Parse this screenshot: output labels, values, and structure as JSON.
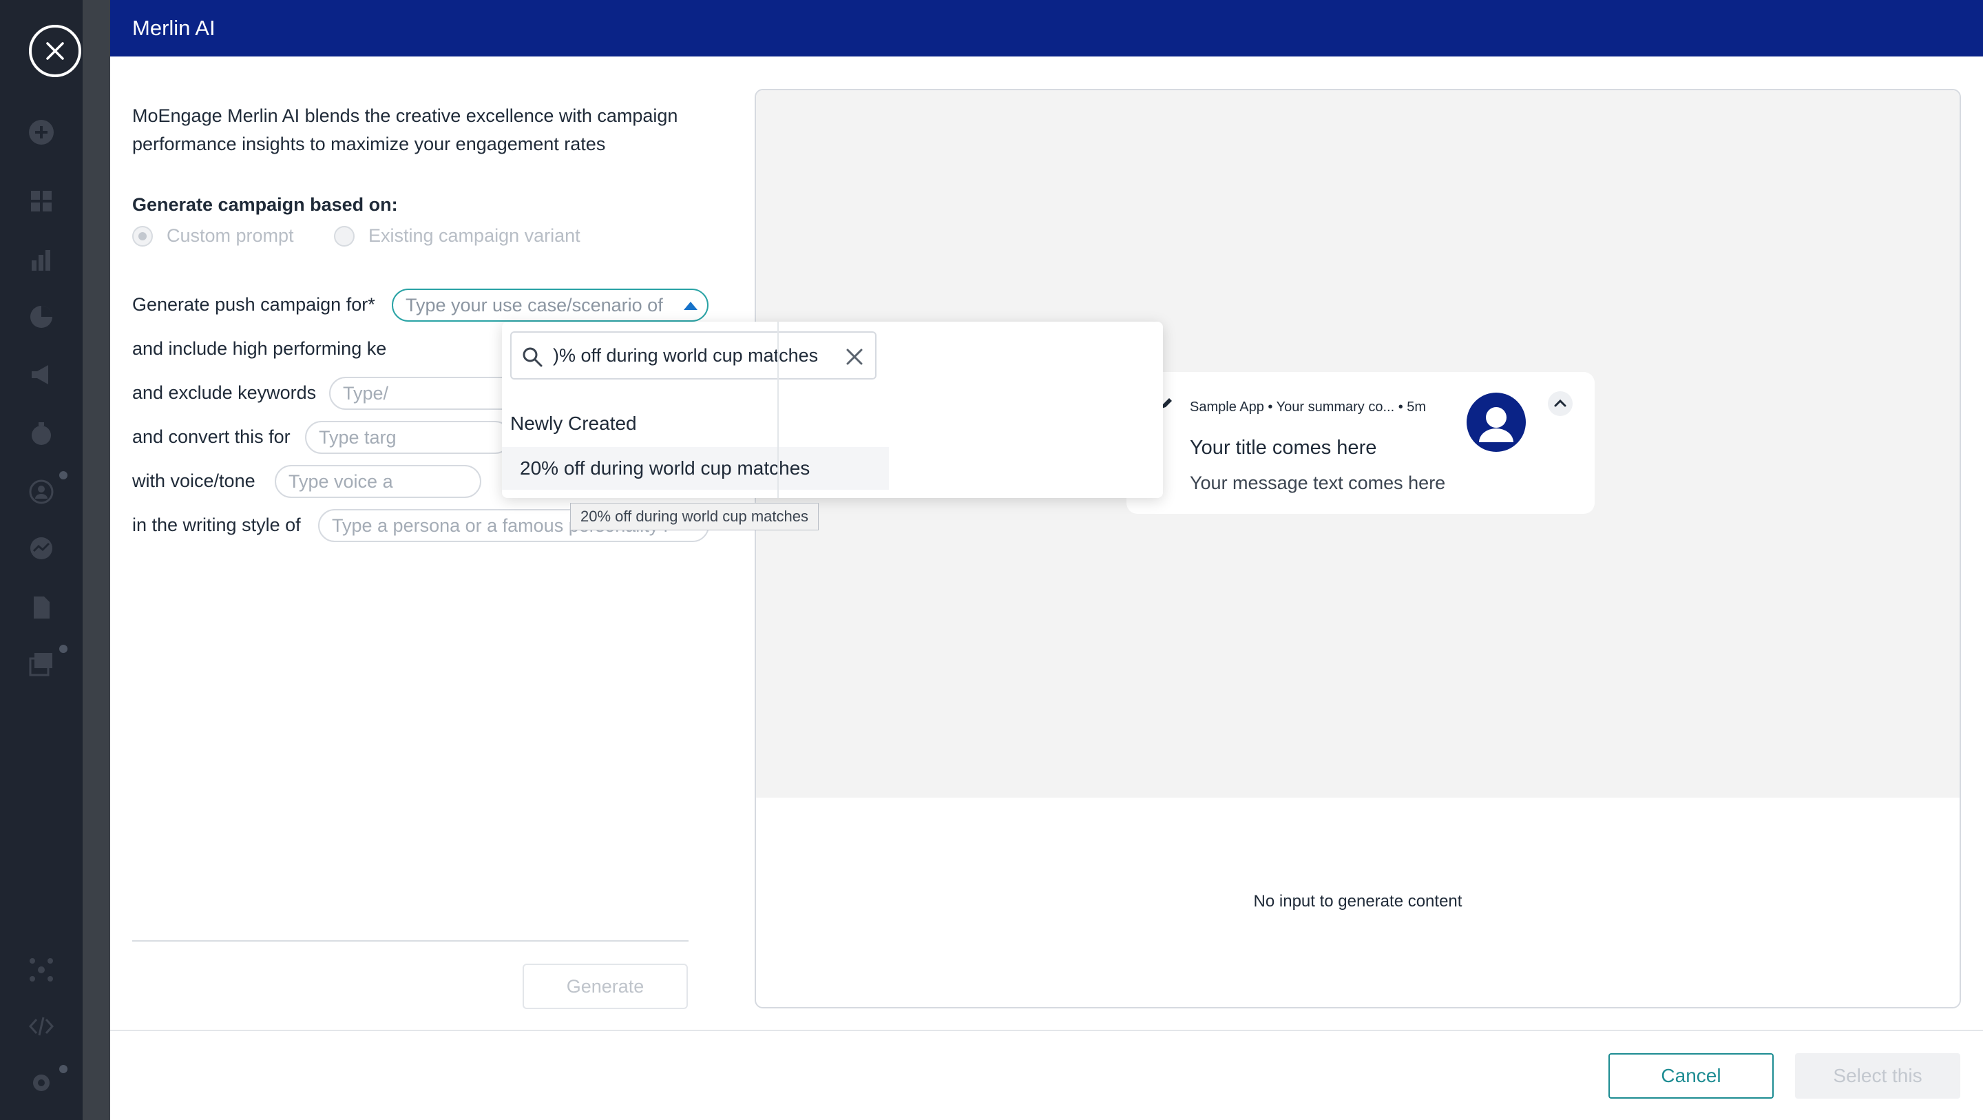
{
  "modal": {
    "title": "Merlin AI",
    "description": "MoEngage Merlin AI blends the creative excellence with campaign performance insights to maximize your engagement rates",
    "generate_based_on_label": "Generate campaign based on:",
    "radio_options": [
      {
        "label": "Custom prompt",
        "selected": true
      },
      {
        "label": "Existing campaign variant",
        "selected": false
      }
    ]
  },
  "form": {
    "rows": [
      {
        "label": "Generate push campaign for*",
        "placeholder": "Type your use case/scenario of"
      },
      {
        "label": "and include high performing ke",
        "placeholder": ""
      },
      {
        "label": "and exclude keywords",
        "placeholder": "Type/"
      },
      {
        "label": "and convert this for",
        "placeholder": "Type targ"
      },
      {
        "label": "with voice/tone",
        "placeholder": "Type voice a"
      },
      {
        "label": "in the writing style of",
        "placeholder": "Type a persona or a famous personality i"
      }
    ],
    "generate_button": "Generate"
  },
  "dropdown": {
    "search_value": ")% off during world cup matches",
    "section_label": "Newly Created",
    "options": [
      "20% off during world cup matches"
    ],
    "tooltip": "20% off during world cup matches"
  },
  "preview": {
    "notification": {
      "meta": "Sample App • Your summary co...  • 5m",
      "title": "Your title comes here",
      "message": "Your message text comes here"
    },
    "empty_state": "No input to generate content"
  },
  "footer": {
    "cancel_label": "Cancel",
    "select_label": "Select this"
  },
  "colors": {
    "header": "#0a2387",
    "accent_teal": "#1d8c92",
    "avatar_blue": "#0a2387"
  }
}
